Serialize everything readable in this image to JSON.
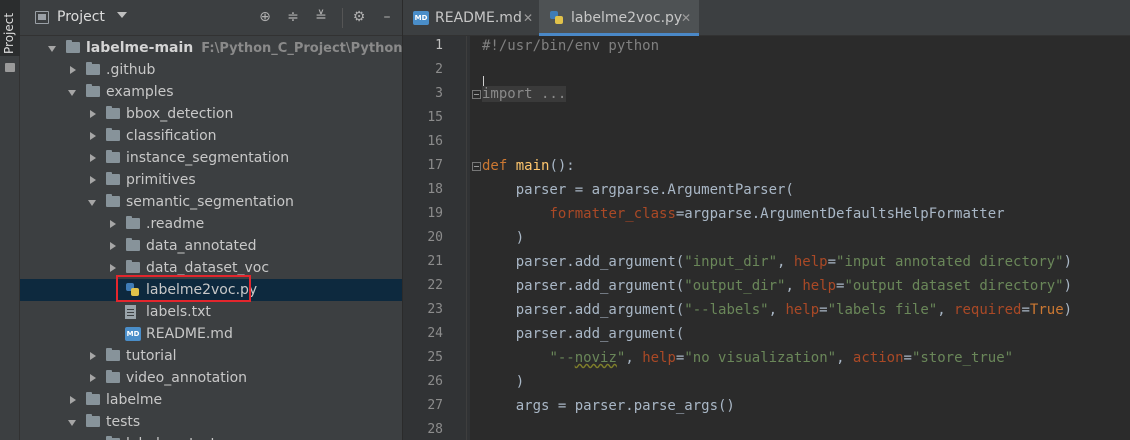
{
  "project_panel": {
    "title": "Project",
    "tool_window_label": "Project",
    "tree": [
      {
        "label": "labelme-main",
        "path": "F:\\Python_C_Project\\Python_Project\\r",
        "type": "folder",
        "expanded": true,
        "depth": 0
      },
      {
        "label": ".github",
        "type": "folder",
        "expanded": false,
        "depth": 1
      },
      {
        "label": "examples",
        "type": "folder",
        "expanded": true,
        "depth": 1
      },
      {
        "label": "bbox_detection",
        "type": "folder",
        "expanded": false,
        "depth": 2
      },
      {
        "label": "classification",
        "type": "folder",
        "expanded": false,
        "depth": 2
      },
      {
        "label": "instance_segmentation",
        "type": "folder",
        "expanded": false,
        "depth": 2
      },
      {
        "label": "primitives",
        "type": "folder",
        "expanded": false,
        "depth": 2
      },
      {
        "label": "semantic_segmentation",
        "type": "folder",
        "expanded": true,
        "depth": 2
      },
      {
        "label": ".readme",
        "type": "folder",
        "expanded": false,
        "depth": 3
      },
      {
        "label": "data_annotated",
        "type": "folder",
        "expanded": false,
        "depth": 3
      },
      {
        "label": "data_dataset_voc",
        "type": "folder",
        "expanded": false,
        "depth": 3
      },
      {
        "label": "labelme2voc.py",
        "type": "py",
        "depth": 3,
        "selected": true
      },
      {
        "label": "labels.txt",
        "type": "txt",
        "depth": 3
      },
      {
        "label": "README.md",
        "type": "md",
        "depth": 3
      },
      {
        "label": "tutorial",
        "type": "folder",
        "expanded": false,
        "depth": 2
      },
      {
        "label": "video_annotation",
        "type": "folder",
        "expanded": false,
        "depth": 2
      },
      {
        "label": "labelme",
        "type": "folder",
        "expanded": false,
        "depth": 1
      },
      {
        "label": "tests",
        "type": "folder",
        "expanded": true,
        "depth": 1
      },
      {
        "label": "labelme_tests",
        "type": "folder",
        "expanded": true,
        "depth": 2
      }
    ]
  },
  "tabs": [
    {
      "label": "README.md",
      "icon": "markdown-icon",
      "active": false
    },
    {
      "label": "labelme2voc.py",
      "icon": "python-file-icon",
      "active": true
    }
  ],
  "md_icon_text": "MD",
  "editor": {
    "lines": [
      {
        "n": "1",
        "html": "<span class='cm'>#!/usr/bin/env python</span>"
      },
      {
        "n": "2",
        "html": ""
      },
      {
        "n": "3",
        "html": "<span class='fold'>import ...</span>"
      },
      {
        "n": "15",
        "html": ""
      },
      {
        "n": "16",
        "html": ""
      },
      {
        "n": "17",
        "html": "<span class='kw'>def </span><span class='fn'>main</span>():"
      },
      {
        "n": "18",
        "html": "    parser = argparse.ArgumentParser("
      },
      {
        "n": "19",
        "html": "        <span class='param'>formatter_class</span>=argparse.ArgumentDefaultsHelpFormatter"
      },
      {
        "n": "20",
        "html": "    )"
      },
      {
        "n": "21",
        "html": "    parser.add_argument(<span class='str'>\"input_dir\"</span>, <span class='param'>help</span>=<span class='str'>\"input annotated directory\"</span>)"
      },
      {
        "n": "22",
        "html": "    parser.add_argument(<span class='str'>\"output_dir\"</span>, <span class='param'>help</span>=<span class='str'>\"output dataset directory\"</span>)"
      },
      {
        "n": "23",
        "html": "    parser.add_argument(<span class='str'>\"--labels\"</span>, <span class='param'>help</span>=<span class='str'>\"labels file\"</span>, <span class='param'>required</span>=<span class='kw'>True</span>)"
      },
      {
        "n": "24",
        "html": "    parser.add_argument("
      },
      {
        "n": "25",
        "html": "        <span class='str'>\"--<span class='sq-under'>noviz</span>\"</span>, <span class='param'>help</span>=<span class='str'>\"no visualization\"</span>, <span class='param'>action</span>=<span class='str'>\"store_true\"</span>"
      },
      {
        "n": "26",
        "html": "    )"
      },
      {
        "n": "27",
        "html": "    args = parser.parse_args()"
      },
      {
        "n": "28",
        "html": ""
      }
    ]
  }
}
